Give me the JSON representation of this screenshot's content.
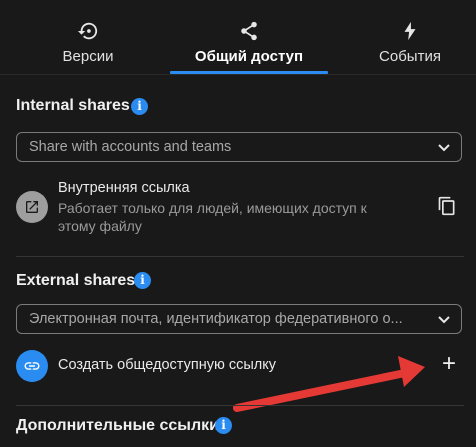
{
  "tabs": [
    {
      "label": "Версии",
      "icon": "history-icon"
    },
    {
      "label": "Общий доступ",
      "icon": "share-icon"
    },
    {
      "label": "События",
      "icon": "lightning-icon"
    }
  ],
  "active_tab": "Общий доступ",
  "internal_shares": {
    "title": "Internal shares",
    "select_placeholder": "Share with accounts and teams",
    "internal_link": {
      "title": "Внутренняя ссылка",
      "description": "Работает только для людей, имеющих доступ к этому файлу"
    }
  },
  "external_shares": {
    "title": "External shares",
    "select_placeholder": "Электронная почта, идентификатор федеративного о...",
    "create_link_label": "Создать общедоступную ссылку",
    "add_symbol": "+"
  },
  "additional_links": {
    "title": "Дополнительные ссылки"
  },
  "colors": {
    "accent": "#2a8cf0",
    "background": "#191919",
    "annotation_arrow": "#e53935"
  }
}
